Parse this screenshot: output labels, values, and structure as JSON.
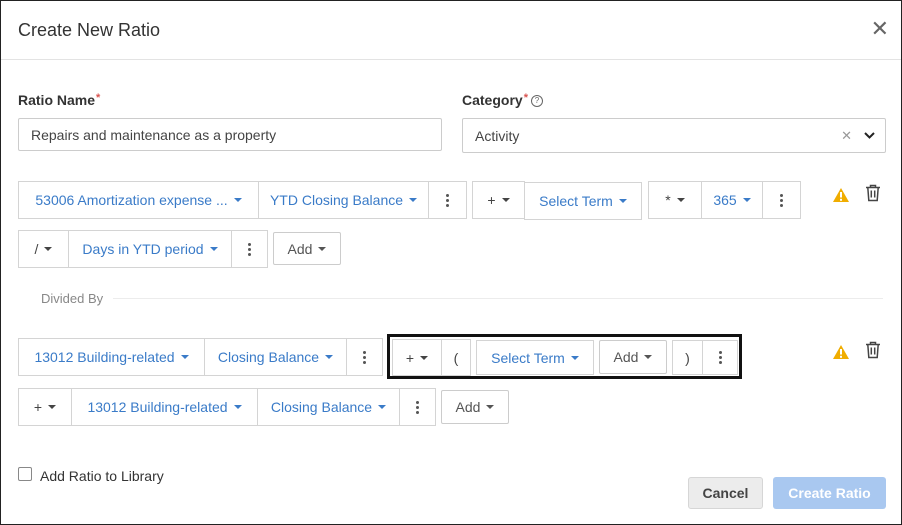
{
  "dialog": {
    "title": "Create New Ratio"
  },
  "form": {
    "ratio_name_label": "Ratio Name",
    "required_mark": "*",
    "ratio_name_value": "Repairs and maintenance as a property",
    "category_label": "Category",
    "category_value": "Activity"
  },
  "numerator": {
    "row1": {
      "account": "53006 Amortization expense ...",
      "balance": "YTD Closing Balance",
      "op1": "+",
      "term1": "Select Term",
      "op2": "*",
      "const": "365"
    },
    "row2": {
      "op": "/",
      "term": "Days in YTD period",
      "add_label": "Add"
    }
  },
  "divided_by_label": "Divided By",
  "denominator": {
    "row1": {
      "account": "13012 Building-related",
      "balance": "Closing Balance",
      "op": "+",
      "open_paren": "(",
      "term": "Select Term",
      "add_label": "Add",
      "close_paren": ")"
    },
    "row2": {
      "op": "+",
      "account": "13012 Building-related",
      "balance": "Closing Balance",
      "add_label": "Add"
    }
  },
  "footer": {
    "add_to_library_label": "Add Ratio to Library",
    "add_to_library_checked": false,
    "cancel_label": "Cancel",
    "create_label": "Create Ratio"
  },
  "colors": {
    "link_blue": "#3a7bc8",
    "warning": "#f0ad00",
    "create_button_bg": "#a9c8f0",
    "required": "#d9534f"
  }
}
